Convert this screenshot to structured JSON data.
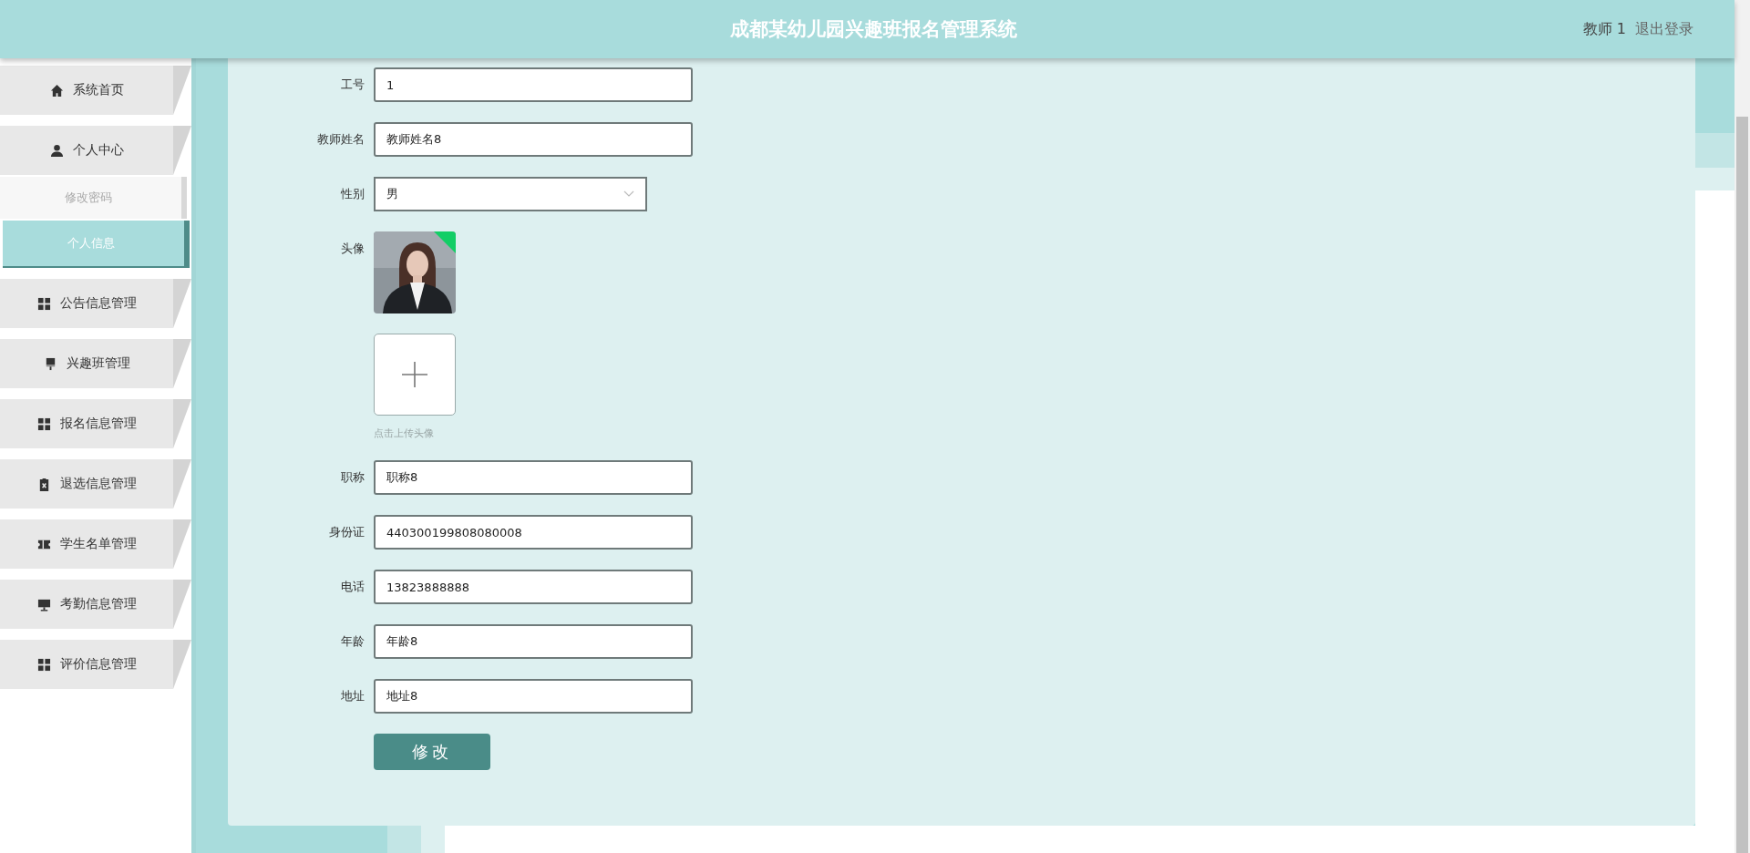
{
  "header": {
    "title": "成都某幼儿园兴趣班报名管理系统",
    "user": "教师 1",
    "logout": "退出登录"
  },
  "sidebar": {
    "items": [
      {
        "label": "系统首页",
        "selected": false
      },
      {
        "label": "个人中心",
        "selected": false,
        "children": [
          {
            "label": "修改密码",
            "selected": false
          },
          {
            "label": "个人信息",
            "selected": true
          }
        ]
      },
      {
        "label": "公告信息管理",
        "selected": false
      },
      {
        "label": "兴趣班管理",
        "selected": false
      },
      {
        "label": "报名信息管理",
        "selected": false
      },
      {
        "label": "退选信息管理",
        "selected": false
      },
      {
        "label": "学生名单管理",
        "selected": false
      },
      {
        "label": "考勤信息管理",
        "selected": false
      },
      {
        "label": "评价信息管理",
        "selected": false
      }
    ]
  },
  "form": {
    "fields": [
      {
        "kind": "text",
        "label": "工号",
        "value": "1"
      },
      {
        "kind": "text",
        "label": "教师姓名",
        "value": "教师姓名8"
      },
      {
        "kind": "select",
        "label": "性别",
        "value": "男"
      },
      {
        "label": "头像",
        "hint": "点击上传头像"
      },
      {
        "kind": "text",
        "label": "职称",
        "value": "职称8"
      },
      {
        "kind": "text",
        "label": "身份证",
        "value": "440300199808080008"
      },
      {
        "kind": "text",
        "label": "电话",
        "value": "13823888888"
      },
      {
        "kind": "text",
        "label": "年龄",
        "value": "年龄8"
      },
      {
        "kind": "text",
        "label": "地址",
        "value": "地址8"
      }
    ],
    "submit": "修改"
  }
}
